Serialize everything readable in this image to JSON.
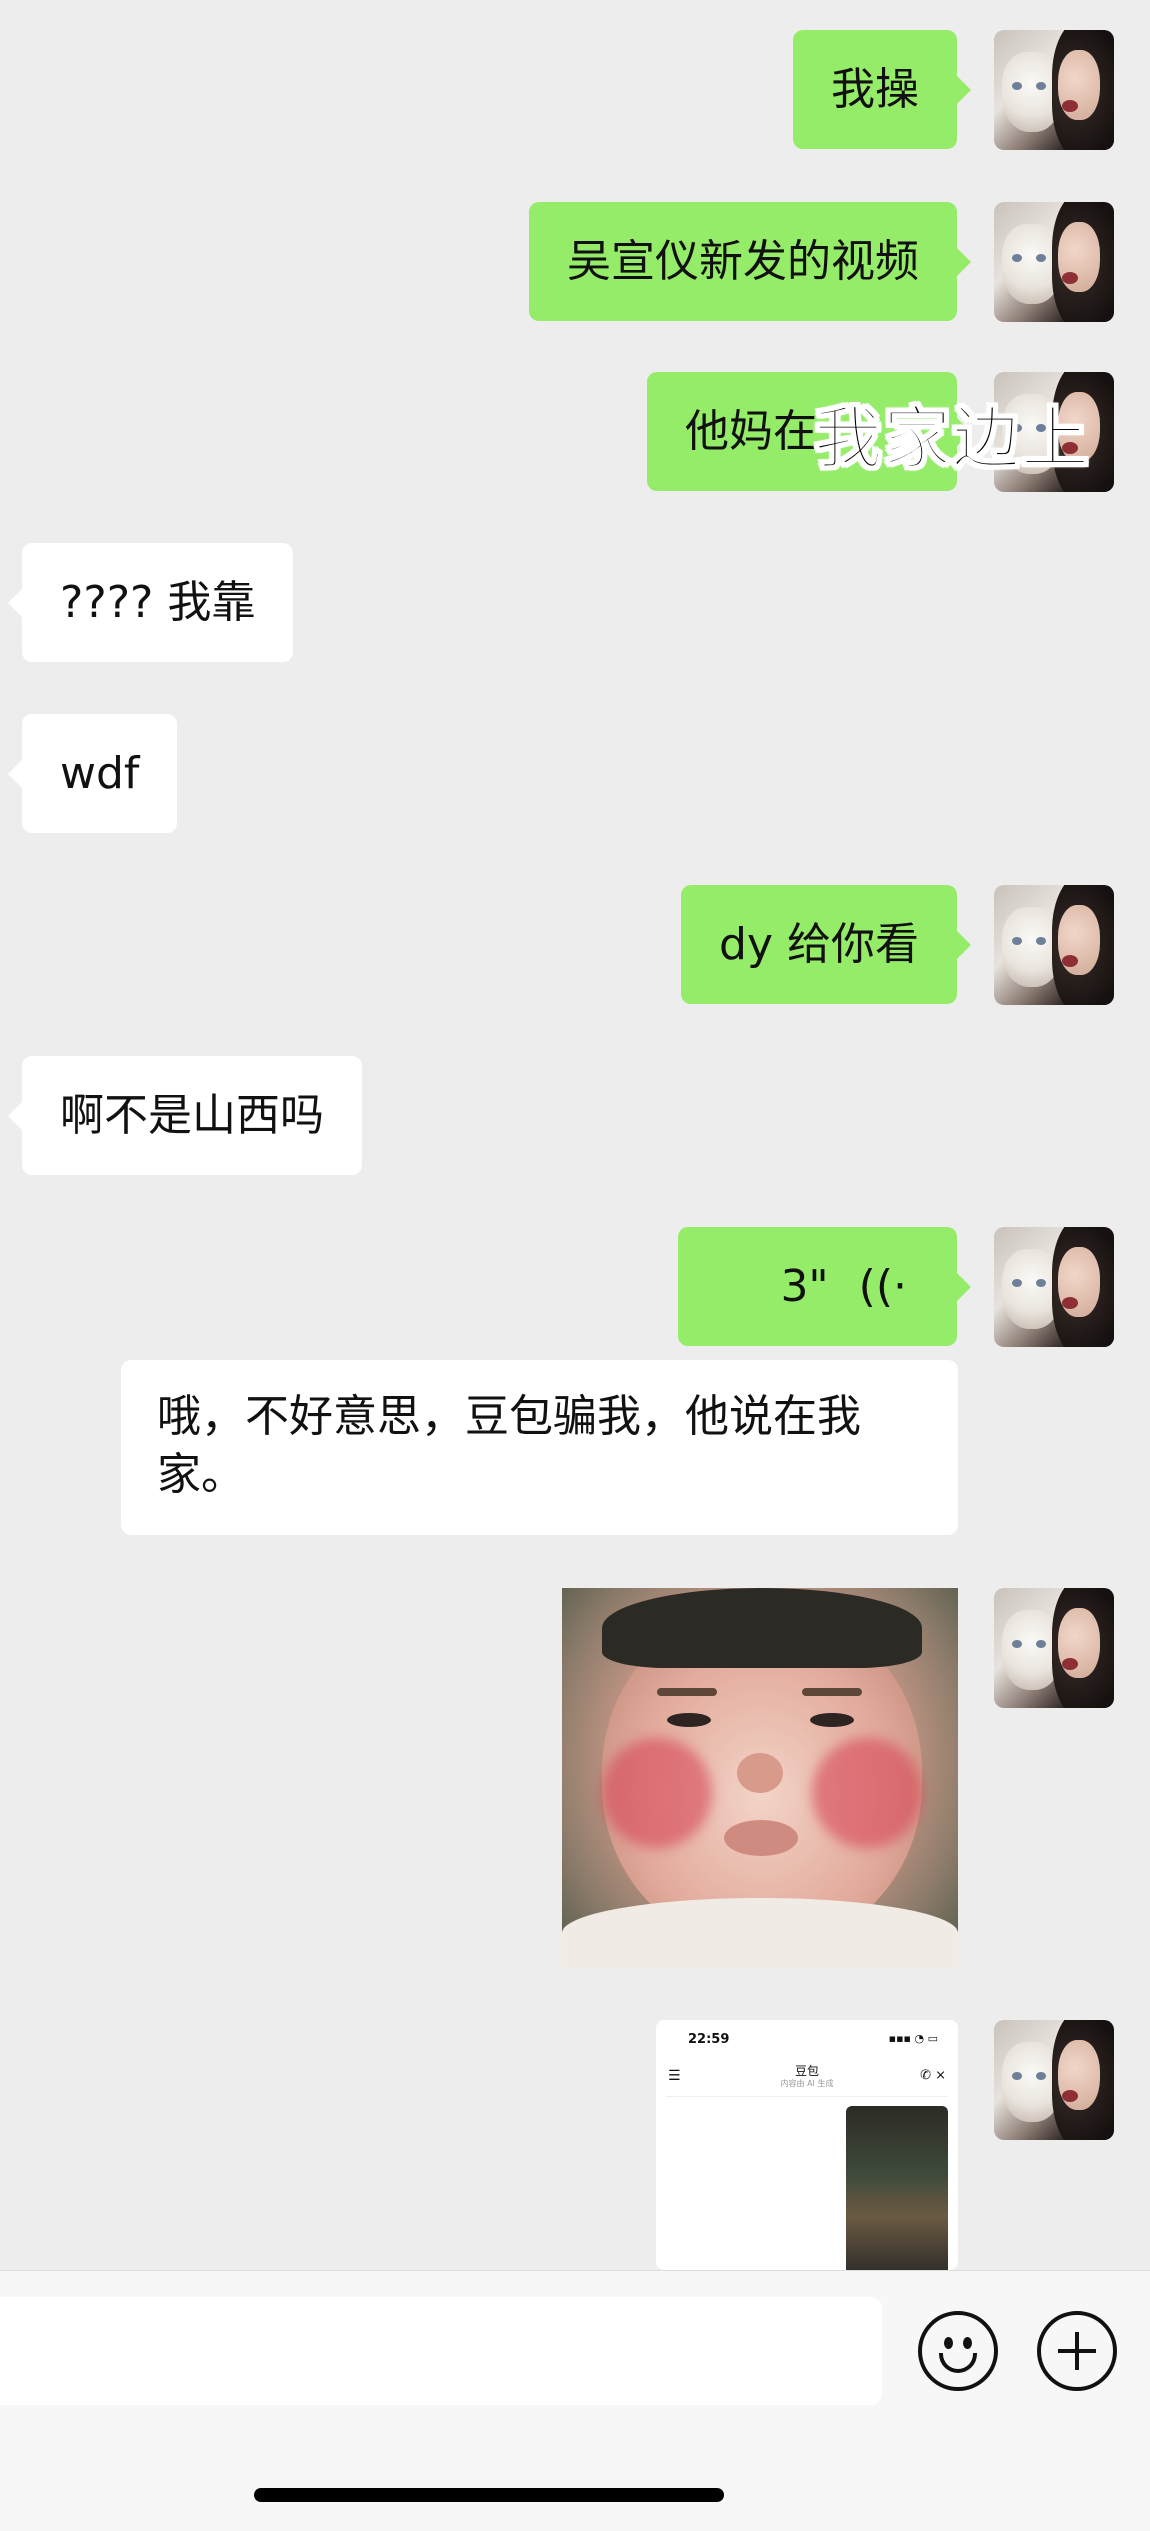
{
  "messages": [
    {
      "sender": "me",
      "text": "我操"
    },
    {
      "sender": "me",
      "text": "吴宣仪新发的视频"
    },
    {
      "sender": "me",
      "text": "他妈在",
      "overlay_caption": "我家边上"
    },
    {
      "sender": "them",
      "text": "???? 我靠"
    },
    {
      "sender": "them",
      "text": "wdf"
    },
    {
      "sender": "me",
      "text": "dy 给你看"
    },
    {
      "sender": "them",
      "text": "啊不是山西吗"
    },
    {
      "sender": "me",
      "type": "voice",
      "duration": "3\"",
      "transcript": "哦，不好意思，豆包骗我，他说在我家。"
    },
    {
      "sender": "me",
      "type": "sticker"
    },
    {
      "sender": "me",
      "type": "screenshot",
      "shot_time": "22:59",
      "shot_title": "豆包",
      "shot_subtitle": "内容由 AI 生成"
    }
  ],
  "icons": {
    "emoji": "emoji-icon",
    "plus": "plus-icon",
    "voice": "voice-wave-icon",
    "avatar": "avatar-image"
  },
  "colors": {
    "background": "#ededed",
    "my_bubble": "#95ec69",
    "their_bubble": "#ffffff",
    "composer": "#f7f7f7"
  }
}
